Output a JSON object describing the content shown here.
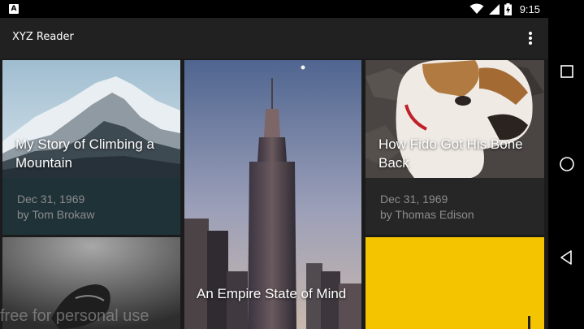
{
  "status_bar": {
    "time": "9:15",
    "notification_letter": "A",
    "icons": [
      "wifi-icon",
      "cell-signal-icon",
      "battery-icon"
    ]
  },
  "toolbar": {
    "title": "XYZ Reader",
    "overflow_icon": "more-vert-icon"
  },
  "articles": [
    {
      "title": "My Story of Climbing a Mountain",
      "date": "Dec 31, 1969",
      "byline": "by Tom Brokaw",
      "meta_bg": "#1f3238"
    },
    {
      "title": "An Empire State of Mind",
      "date": "",
      "byline": ""
    },
    {
      "title": "How Fido Got His Bone Back",
      "date": "Dec 31, 1969",
      "byline": "by Thomas Edison",
      "meta_bg": "#262626"
    },
    {
      "title": "",
      "date": "",
      "byline": ""
    },
    {
      "title": "",
      "date": "",
      "byline": "",
      "image_color": "#f5c400"
    }
  ],
  "watermark": "free for personal use",
  "nav_bar": {
    "icons": [
      "recents-icon",
      "home-icon",
      "back-icon"
    ]
  },
  "colors": {
    "status_bar": "#000000",
    "toolbar": "#212121",
    "background": "#1b1b1b",
    "meta_text": "#8c8c8c",
    "card_yellow": "#f5c400"
  }
}
